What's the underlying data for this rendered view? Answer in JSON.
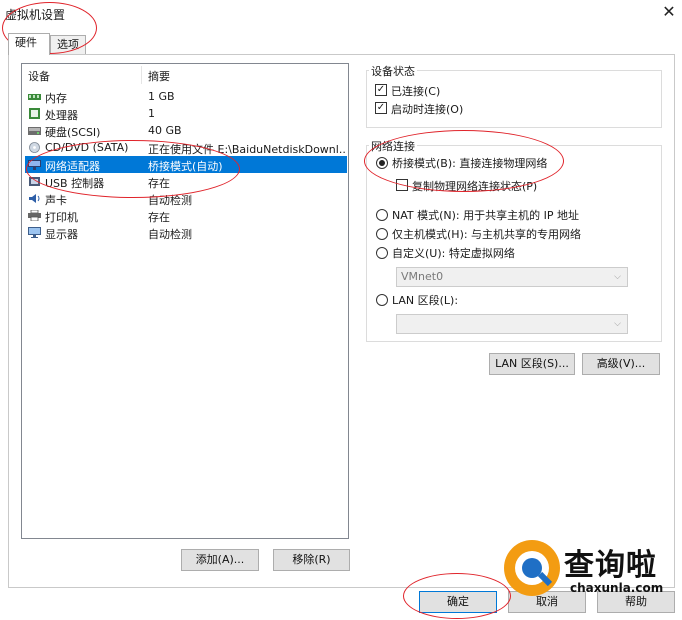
{
  "window": {
    "title": "虚拟机设置"
  },
  "tabs": [
    {
      "label": "硬件"
    },
    {
      "label": "选项"
    }
  ],
  "device_list": {
    "headers": {
      "device": "设备",
      "summary": "摘要"
    },
    "rows": [
      {
        "name": "内存",
        "summary": "1 GB",
        "icon": "memory-icon"
      },
      {
        "name": "处理器",
        "summary": "1",
        "icon": "cpu-icon"
      },
      {
        "name": "硬盘(SCSI)",
        "summary": "40 GB",
        "icon": "hard-disk-icon"
      },
      {
        "name": "CD/DVD (SATA)",
        "summary": "正在使用文件 E:\\BaiduNetdiskDownl...",
        "icon": "cd-dvd-icon"
      },
      {
        "name": "网络适配器",
        "summary": "桥接模式(自动)",
        "icon": "network-adapter-icon",
        "selected": true
      },
      {
        "name": "USB 控制器",
        "summary": "存在",
        "icon": "usb-icon"
      },
      {
        "name": "声卡",
        "summary": "自动检测",
        "icon": "sound-card-icon"
      },
      {
        "name": "打印机",
        "summary": "存在",
        "icon": "printer-icon"
      },
      {
        "name": "显示器",
        "summary": "自动检测",
        "icon": "monitor-icon"
      }
    ],
    "buttons": {
      "add": "添加(A)...",
      "remove": "移除(R)"
    }
  },
  "device_status": {
    "title": "设备状态",
    "connected": {
      "label": "已连接(C)",
      "checked": true
    },
    "connect_at_power_on": {
      "label": "启动时连接(O)",
      "checked": true
    }
  },
  "network": {
    "title": "网络连接",
    "bridged": {
      "label": "桥接模式(B): 直接连接物理网络",
      "selected": true
    },
    "replicate": {
      "label": "复制物理网络连接状态(P)",
      "checked": false
    },
    "nat": {
      "label": "NAT 模式(N): 用于共享主机的 IP 地址",
      "selected": false
    },
    "host_only": {
      "label": "仅主机模式(H): 与主机共享的专用网络",
      "selected": false
    },
    "custom": {
      "label": "自定义(U): 特定虚拟网络",
      "selected": false
    },
    "custom_value": "VMnet0",
    "lan_segment": {
      "label": "LAN 区段(L):",
      "selected": false
    },
    "lan_value": "",
    "buttons": {
      "lan_segments": "LAN 区段(S)...",
      "advanced": "高级(V)..."
    }
  },
  "footer": {
    "ok": "确定",
    "cancel": "取消",
    "help": "帮助"
  },
  "watermark": {
    "cn": "查询啦",
    "url": "chaxunla.com"
  },
  "colors": {
    "selection": "#0078d7",
    "annotation": "#e0242b",
    "watermark_orange": "#f39c12",
    "watermark_blue": "#1f6fc5"
  }
}
